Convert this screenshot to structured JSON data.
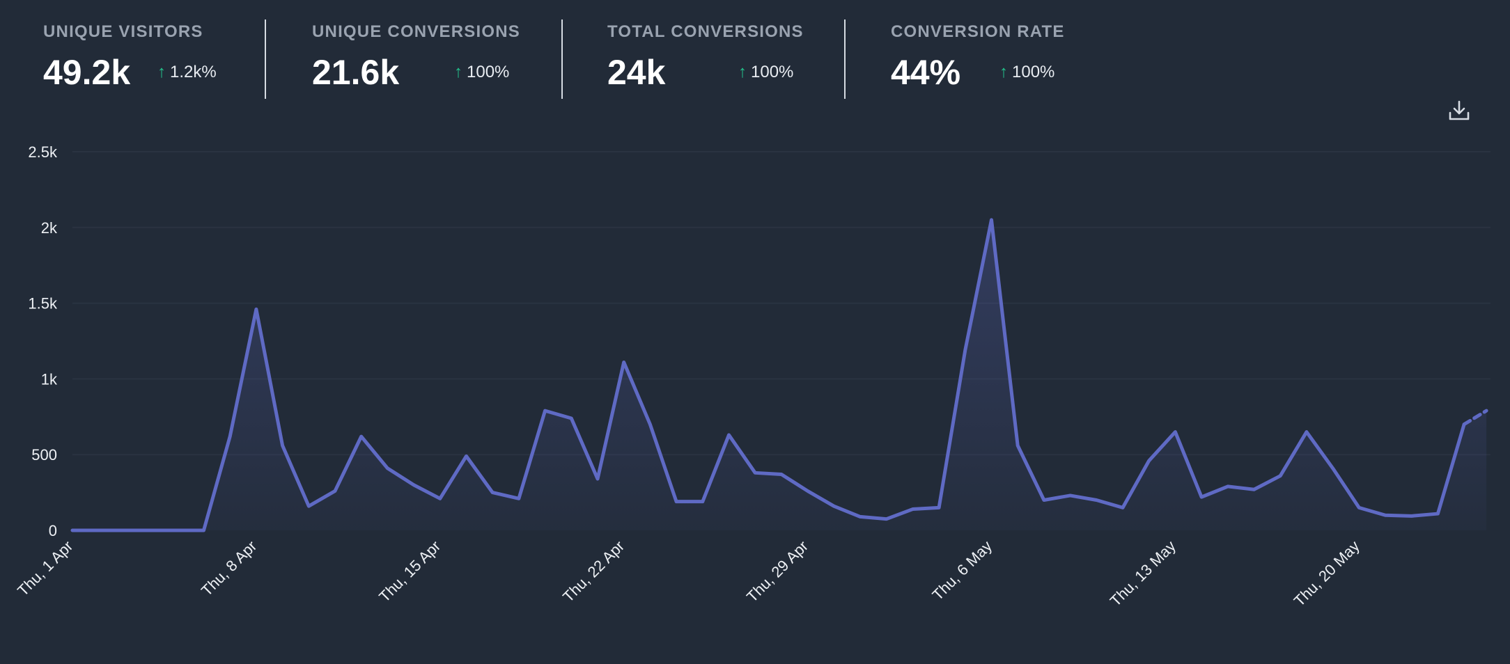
{
  "stats": [
    {
      "label": "UNIQUE VISITORS",
      "value": "49.2k",
      "change": "1.2k%"
    },
    {
      "label": "UNIQUE CONVERSIONS",
      "value": "21.6k",
      "change": "100%"
    },
    {
      "label": "TOTAL CONVERSIONS",
      "value": "24k",
      "change": "100%"
    },
    {
      "label": "CONVERSION RATE",
      "value": "44%",
      "change": "100%"
    }
  ],
  "icons": {
    "download": "download-icon",
    "change": "arrow-up-icon"
  },
  "colors": {
    "line": "#5f6ac4",
    "change_positive": "#22c08a",
    "background": "#222b38"
  },
  "chart_data": {
    "type": "area",
    "title": "",
    "xlabel": "",
    "ylabel": "",
    "ylim": [
      0,
      2500
    ],
    "y_ticks": [
      0,
      500,
      1000,
      1500,
      2000,
      2500
    ],
    "y_tick_labels": [
      "0",
      "500",
      "1k",
      "1.5k",
      "2k",
      "2.5k"
    ],
    "x_tick_labels": [
      "Thu, 1 Apr",
      "Thu, 8 Apr",
      "Thu, 15 Apr",
      "Thu, 22 Apr",
      "Thu, 29 Apr",
      "Thu, 6 May",
      "Thu, 13 May",
      "Thu, 20 May"
    ],
    "grid": true,
    "x_start": "2021-04-01",
    "series": [
      {
        "values": [
          0,
          0,
          0,
          0,
          0,
          0,
          620,
          1460,
          560,
          160,
          260,
          620,
          410,
          300,
          210,
          490,
          250,
          210,
          790,
          740,
          340,
          1110,
          700,
          190,
          190,
          630,
          380,
          370,
          260,
          160,
          90,
          75,
          140,
          150,
          1190,
          2050,
          560,
          200,
          230,
          200,
          150,
          460,
          650,
          220,
          290,
          270,
          360,
          650,
          410,
          150,
          100,
          95,
          110,
          700
        ],
        "partial_last": 790
      }
    ]
  }
}
